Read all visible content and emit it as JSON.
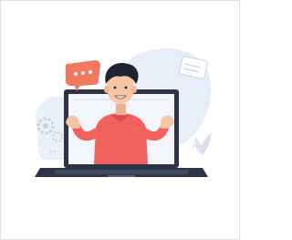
{
  "illustration": {
    "subject": "man-waving-from-laptop-screen",
    "colors": {
      "frame_border": "#e2e2e2",
      "background_blob": "#e7eef7",
      "laptop_body": "#2d3446",
      "laptop_screen": "#f2f6fb",
      "shirt": "#f1625f",
      "skin": "#f5c6a5",
      "hair": "#1f2433",
      "chat_bubble": "#f1795f",
      "accent_gray": "#c8d2df"
    },
    "icons": [
      "chat-bubble-icon",
      "gear-icon",
      "document-icon",
      "bar-chart-icon",
      "plant-icon"
    ]
  }
}
